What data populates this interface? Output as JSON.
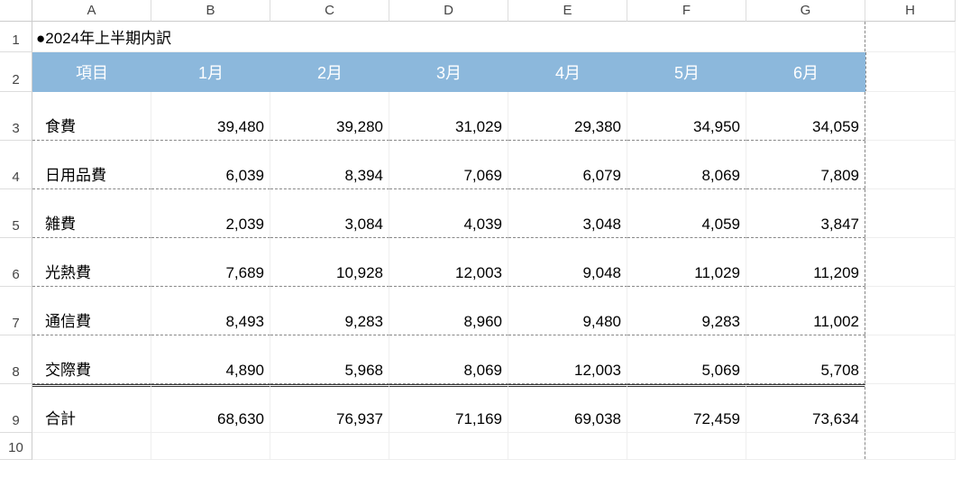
{
  "columns": [
    "A",
    "B",
    "C",
    "D",
    "E",
    "F",
    "G",
    "H"
  ],
  "title": "●2024年上半期内訳",
  "headers": [
    "項目",
    "1月",
    "2月",
    "3月",
    "4月",
    "5月",
    "6月"
  ],
  "rows": [
    {
      "label": "食費",
      "values": [
        "39,480",
        "39,280",
        "31,029",
        "29,380",
        "34,950",
        "34,059"
      ]
    },
    {
      "label": "日用品費",
      "values": [
        "6,039",
        "8,394",
        "7,069",
        "6,079",
        "8,069",
        "7,809"
      ]
    },
    {
      "label": "雑費",
      "values": [
        "2,039",
        "3,084",
        "4,039",
        "3,048",
        "4,059",
        "3,847"
      ]
    },
    {
      "label": "光熱費",
      "values": [
        "7,689",
        "10,928",
        "12,003",
        "9,048",
        "11,029",
        "11,209"
      ]
    },
    {
      "label": "通信費",
      "values": [
        "8,493",
        "9,283",
        "8,960",
        "9,480",
        "9,283",
        "11,002"
      ]
    },
    {
      "label": "交際費",
      "values": [
        "4,890",
        "5,968",
        "8,069",
        "12,003",
        "5,069",
        "5,708"
      ]
    }
  ],
  "total": {
    "label": "合計",
    "values": [
      "68,630",
      "76,937",
      "71,169",
      "69,038",
      "72,459",
      "73,634"
    ]
  },
  "rowNumbers": [
    "1",
    "2",
    "3",
    "4",
    "5",
    "6",
    "7",
    "8",
    "9",
    "10"
  ]
}
